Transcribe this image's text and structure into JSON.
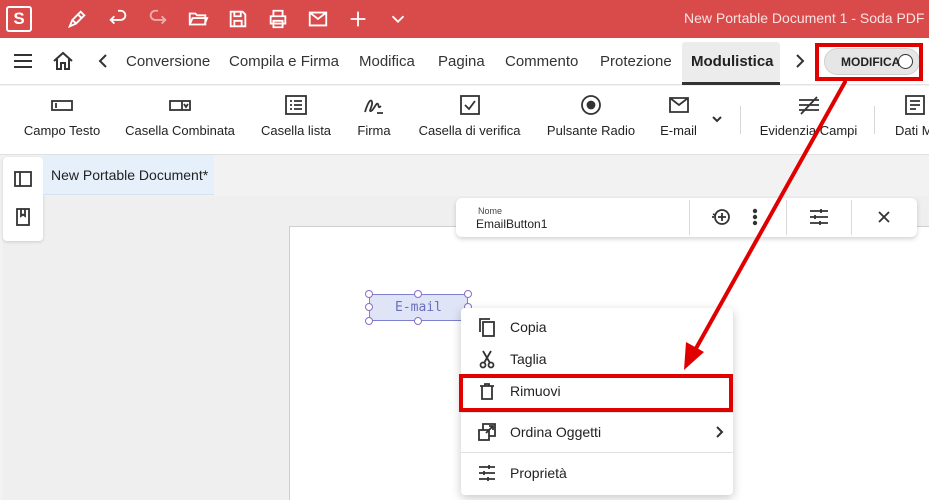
{
  "titlebar": {
    "app_letter": "S",
    "document_title": "New Portable Document 1   -   Soda PDF"
  },
  "quick_access": [
    "pen-icon",
    "undo-icon",
    "redo-icon",
    "open-folder-icon",
    "save-icon",
    "print-icon",
    "email-icon",
    "add-icon",
    "chevron-down-icon"
  ],
  "menubar": {
    "tabs": [
      "Conversione",
      "Compila e Firma",
      "Modifica",
      "Pagina",
      "Commento",
      "Protezione",
      "Modulistica"
    ],
    "active_tab": "Modulistica",
    "mode_toggle_label": "MODIFICA"
  },
  "ribbon": {
    "tools": [
      {
        "label": "Campo Testo",
        "icon": "text-field-icon"
      },
      {
        "label": "Casella Combinata",
        "icon": "combo-box-icon"
      },
      {
        "label": "Casella lista",
        "icon": "list-box-icon"
      },
      {
        "label": "Firma",
        "icon": "signature-icon"
      },
      {
        "label": "Casella di verifica",
        "icon": "checkbox-icon"
      },
      {
        "label": "Pulsante Radio",
        "icon": "radio-button-icon"
      },
      {
        "label": "E-mail",
        "icon": "email-icon"
      },
      {
        "label": "Evidenzia Campi",
        "icon": "highlight-fields-icon"
      },
      {
        "label": "Dati M",
        "icon": "form-data-icon"
      }
    ]
  },
  "document_tab": {
    "title": "New Portable Document*"
  },
  "field_toolbar": {
    "name_label": "Nome",
    "name_value": "EmailButton1"
  },
  "email_field": {
    "text": "E-mail"
  },
  "context_menu": {
    "items": [
      {
        "label": "Copia",
        "icon": "copy-icon"
      },
      {
        "label": "Taglia",
        "icon": "scissors-icon"
      },
      {
        "label": "Rimuovi",
        "icon": "trash-icon"
      },
      {
        "label": "Ordina Oggetti",
        "icon": "arrange-icon"
      },
      {
        "label": "Proprietà",
        "icon": "properties-icon"
      }
    ]
  },
  "colors": {
    "title_bar": "#d94a4a",
    "annotation": "#e00000",
    "field_fill": "#dfe5f6",
    "field_border": "#7d7fd0"
  }
}
